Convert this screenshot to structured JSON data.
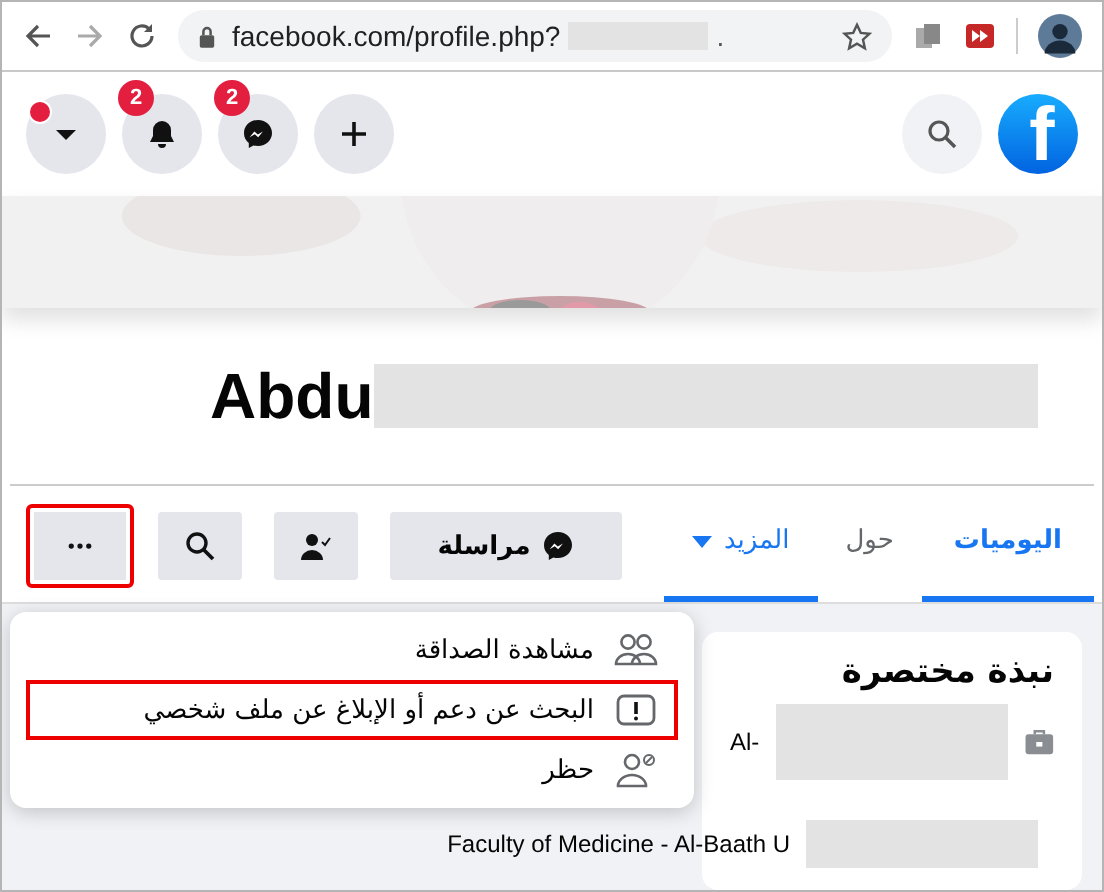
{
  "browser": {
    "url": "facebook.com/profile.php?",
    "url_tail": "."
  },
  "header": {
    "buttons": [
      {
        "kind": "create",
        "dot": false
      },
      {
        "kind": "messenger",
        "dot": false,
        "badge": "2"
      },
      {
        "kind": "notifications",
        "dot": false,
        "badge": "2"
      },
      {
        "kind": "account",
        "dot": true
      }
    ],
    "logo": "f"
  },
  "profile": {
    "name": "Abdu"
  },
  "actions": [
    {
      "kind": "message",
      "label": "مراسلة",
      "highlighted": false
    },
    {
      "kind": "friends",
      "highlighted": false
    },
    {
      "kind": "search",
      "highlighted": false
    },
    {
      "kind": "more",
      "highlighted": true
    }
  ],
  "tabs": [
    {
      "label": "اليوميات",
      "selected": true
    },
    {
      "label": "حول",
      "selected": false
    },
    {
      "label": "المزيد",
      "selected": false,
      "expanded": true
    }
  ],
  "menu": [
    {
      "kind": "friendship",
      "label": "مشاهدة الصداقة",
      "highlighted": false
    },
    {
      "kind": "report",
      "label": "البحث عن دعم أو الإبلاغ عن ملف شخصي",
      "highlighted": true
    },
    {
      "kind": "block",
      "label": "حظر",
      "highlighted": false
    }
  ],
  "intro": {
    "title": "نبذة مختصرة",
    "rows": [
      {
        "kind": "work",
        "text": "Al-"
      },
      {
        "kind": "education",
        "text": "Faculty of Medicine - Al-Baath U"
      }
    ]
  }
}
